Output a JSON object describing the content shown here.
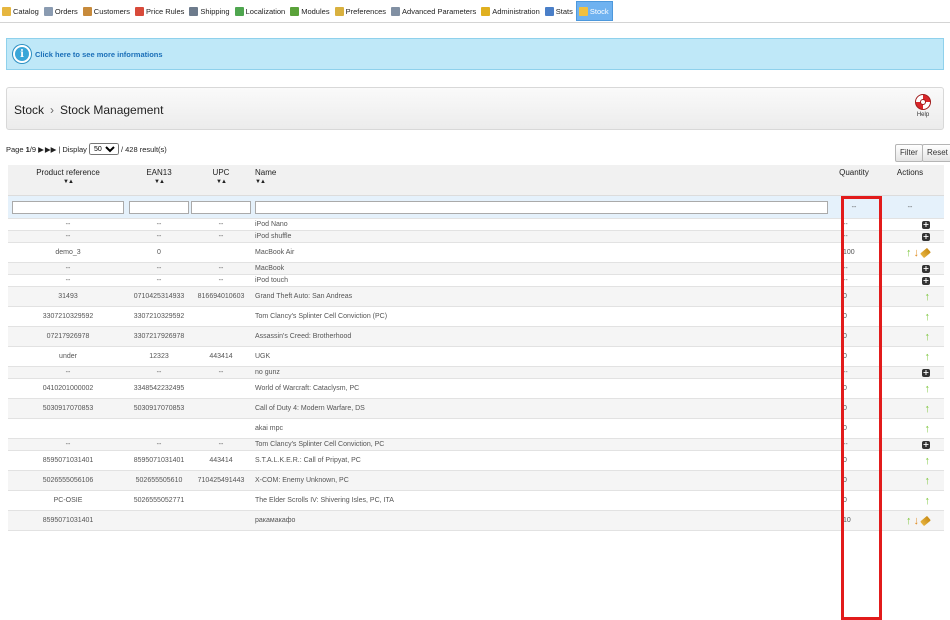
{
  "nav": {
    "tabs": [
      {
        "label": "Catalog",
        "icon": "folder-icon",
        "color": "#e6b63f"
      },
      {
        "label": "Orders",
        "icon": "orders-icon",
        "color": "#8a9bb1"
      },
      {
        "label": "Customers",
        "icon": "customers-icon",
        "color": "#c78a3b"
      },
      {
        "label": "Price Rules",
        "icon": "price-rules-icon",
        "color": "#d84a3a"
      },
      {
        "label": "Shipping",
        "icon": "shipping-icon",
        "color": "#6d7b8c"
      },
      {
        "label": "Localization",
        "icon": "globe-icon",
        "color": "#4fa64f"
      },
      {
        "label": "Modules",
        "icon": "modules-icon",
        "color": "#5aa23a"
      },
      {
        "label": "Preferences",
        "icon": "preferences-icon",
        "color": "#d9b13f"
      },
      {
        "label": "Advanced Parameters",
        "icon": "wrench-icon",
        "color": "#8190a3"
      },
      {
        "label": "Administration",
        "icon": "key-icon",
        "color": "#e0b020"
      },
      {
        "label": "Stats",
        "icon": "stats-icon",
        "color": "#4a7fc8"
      },
      {
        "label": "Stock",
        "icon": "stock-icon",
        "color": "#f0c040"
      }
    ],
    "active_tab": "Stock"
  },
  "info_bar": {
    "text": "Click here to see more informations",
    "icon": "info-icon"
  },
  "header": {
    "section": "Stock",
    "separator": "›",
    "title": "Stock Management",
    "help_label": "Help"
  },
  "pagination": {
    "page_label": "Page",
    "current_page": "1",
    "total_pages": "9",
    "display_label": "Display",
    "per_page": "50",
    "results": "428",
    "results_label": "result(s)"
  },
  "toolbar": {
    "filter_label": "Filter",
    "reset_label": "Reset"
  },
  "table": {
    "columns": [
      "Product reference",
      "EAN13",
      "UPC",
      "Name",
      "Quantity",
      "Actions"
    ],
    "sort_glyph": "▼▲",
    "filter_quantity": "--",
    "filter_actions": "--",
    "rows": [
      {
        "ref": "--",
        "ean": "--",
        "upc": "--",
        "name": "iPod Nano",
        "qty": "--",
        "actions": "plus"
      },
      {
        "ref": "--",
        "ean": "--",
        "upc": "--",
        "name": "iPod shuffle",
        "qty": "--",
        "actions": "plus"
      },
      {
        "ref": "demo_3",
        "ean": "0",
        "upc": "",
        "name": "MacBook Air",
        "qty": "100",
        "actions": "full"
      },
      {
        "ref": "--",
        "ean": "--",
        "upc": "--",
        "name": "MacBook",
        "qty": "--",
        "actions": "plus"
      },
      {
        "ref": "--",
        "ean": "--",
        "upc": "--",
        "name": "iPod touch",
        "qty": "--",
        "actions": "plus"
      },
      {
        "ref": "31493",
        "ean": "0710425314933",
        "upc": "816694010603",
        "name": "Grand Theft Auto: San Andreas",
        "qty": "0",
        "actions": "up"
      },
      {
        "ref": "3307210329592",
        "ean": "3307210329592",
        "upc": "",
        "name": "Tom Clancy's Splinter Cell Conviction (PC)",
        "qty": "0",
        "actions": "up"
      },
      {
        "ref": "07217926978",
        "ean": "3307217926978",
        "upc": "",
        "name": "Assassin's Creed: Brotherhood",
        "qty": "0",
        "actions": "up"
      },
      {
        "ref": "under",
        "ean": "12323",
        "upc": "443414",
        "name": "UGK",
        "qty": "0",
        "actions": "up"
      },
      {
        "ref": "--",
        "ean": "--",
        "upc": "--",
        "name": "no gunz",
        "qty": "--",
        "actions": "plus"
      },
      {
        "ref": "0410201000002",
        "ean": "3348542232495",
        "upc": "",
        "name": "World of Warcraft: Cataclysm, PC",
        "qty": "0",
        "actions": "up"
      },
      {
        "ref": "5030917070853",
        "ean": "5030917070853",
        "upc": "",
        "name": "Call of Duty 4: Modern Warfare, DS",
        "qty": "0",
        "actions": "up"
      },
      {
        "ref": "",
        "ean": "",
        "upc": "",
        "name": "akai mpc",
        "qty": "0",
        "actions": "up"
      },
      {
        "ref": "--",
        "ean": "--",
        "upc": "--",
        "name": "Tom Clancy's Splinter Cell Conviction, PC",
        "qty": "--",
        "actions": "plus"
      },
      {
        "ref": "8595071031401",
        "ean": "8595071031401",
        "upc": "443414",
        "name": "S.T.A.L.K.E.R.: Call of Pripyat, PC",
        "qty": "0",
        "actions": "up"
      },
      {
        "ref": "5026555056106",
        "ean": "502655505610",
        "upc": "710425491443",
        "name": "X-COM: Enemy Unknown, PC",
        "qty": "0",
        "actions": "up"
      },
      {
        "ref": "PC-OSIE",
        "ean": "5026555052771",
        "upc": "",
        "name": "The Elder Scrolls IV: Shivering Isles, PC, ITA",
        "qty": "0",
        "actions": "up"
      },
      {
        "ref": "8595071031401",
        "ean": "",
        "upc": "",
        "name": "ракамакафо",
        "qty": "10",
        "actions": "full"
      }
    ]
  },
  "colors": {
    "highlight": "#e21b1b",
    "active_tab": "#6fb2f0",
    "info_bg": "#bfe8f8",
    "link": "#1b6fb8"
  }
}
